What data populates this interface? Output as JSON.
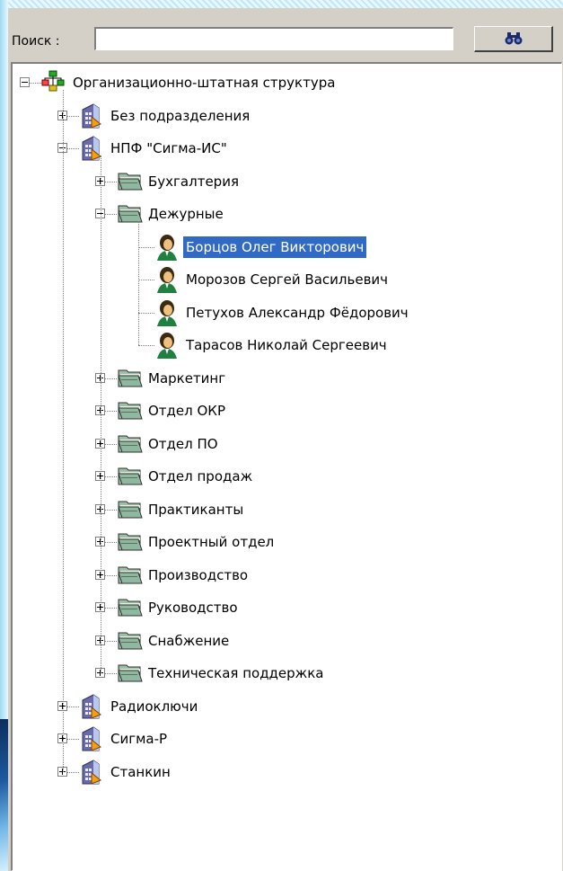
{
  "search": {
    "label": "Поиск :",
    "value": "",
    "button_icon": "binoculars-icon"
  },
  "tree": {
    "root": "Организационно-штатная структура",
    "items": [
      {
        "label": "Без подразделения",
        "level": 1,
        "icon": "building-icon",
        "state": "collapsed"
      },
      {
        "label": "НПФ \"Сигма-ИС\"",
        "level": 1,
        "icon": "building-icon",
        "state": "expanded"
      },
      {
        "label": "Бухгалтерия",
        "level": 2,
        "icon": "folder-icon",
        "state": "collapsed"
      },
      {
        "label": "Дежурные",
        "level": 2,
        "icon": "folder-icon",
        "state": "expanded"
      },
      {
        "label": "Борцов Олег Викторович",
        "level": 3,
        "icon": "person-icon",
        "state": "leaf",
        "selected": true
      },
      {
        "label": "Морозов Сергей Васильевич",
        "level": 3,
        "icon": "person-icon",
        "state": "leaf"
      },
      {
        "label": "Петухов Александр Фёдорович",
        "level": 3,
        "icon": "person-icon",
        "state": "leaf"
      },
      {
        "label": "Тарасов Николай Сергеевич",
        "level": 3,
        "icon": "person-icon",
        "state": "leaf"
      },
      {
        "label": "Маркетинг",
        "level": 2,
        "icon": "folder-icon",
        "state": "collapsed"
      },
      {
        "label": "Отдел ОКР",
        "level": 2,
        "icon": "folder-icon",
        "state": "collapsed"
      },
      {
        "label": "Отдел ПО",
        "level": 2,
        "icon": "folder-icon",
        "state": "collapsed"
      },
      {
        "label": "Отдел продаж",
        "level": 2,
        "icon": "folder-icon",
        "state": "collapsed"
      },
      {
        "label": "Практиканты",
        "level": 2,
        "icon": "folder-icon",
        "state": "collapsed"
      },
      {
        "label": "Проектный отдел",
        "level": 2,
        "icon": "folder-icon",
        "state": "collapsed"
      },
      {
        "label": "Производство",
        "level": 2,
        "icon": "folder-icon",
        "state": "collapsed"
      },
      {
        "label": "Руководство",
        "level": 2,
        "icon": "folder-icon",
        "state": "collapsed"
      },
      {
        "label": "Снабжение",
        "level": 2,
        "icon": "folder-icon",
        "state": "collapsed"
      },
      {
        "label": "Техническая поддержка",
        "level": 2,
        "icon": "folder-icon",
        "state": "collapsed"
      },
      {
        "label": "Радиоключи",
        "level": 1,
        "icon": "building-icon",
        "state": "collapsed"
      },
      {
        "label": "Сигма-Р",
        "level": 1,
        "icon": "building-icon",
        "state": "collapsed"
      },
      {
        "label": "Станкин",
        "level": 1,
        "icon": "building-icon",
        "state": "collapsed"
      }
    ]
  },
  "colors": {
    "selection": "#316ac5",
    "panel": "#d4d0c8",
    "folder": "#8fb8a0"
  }
}
